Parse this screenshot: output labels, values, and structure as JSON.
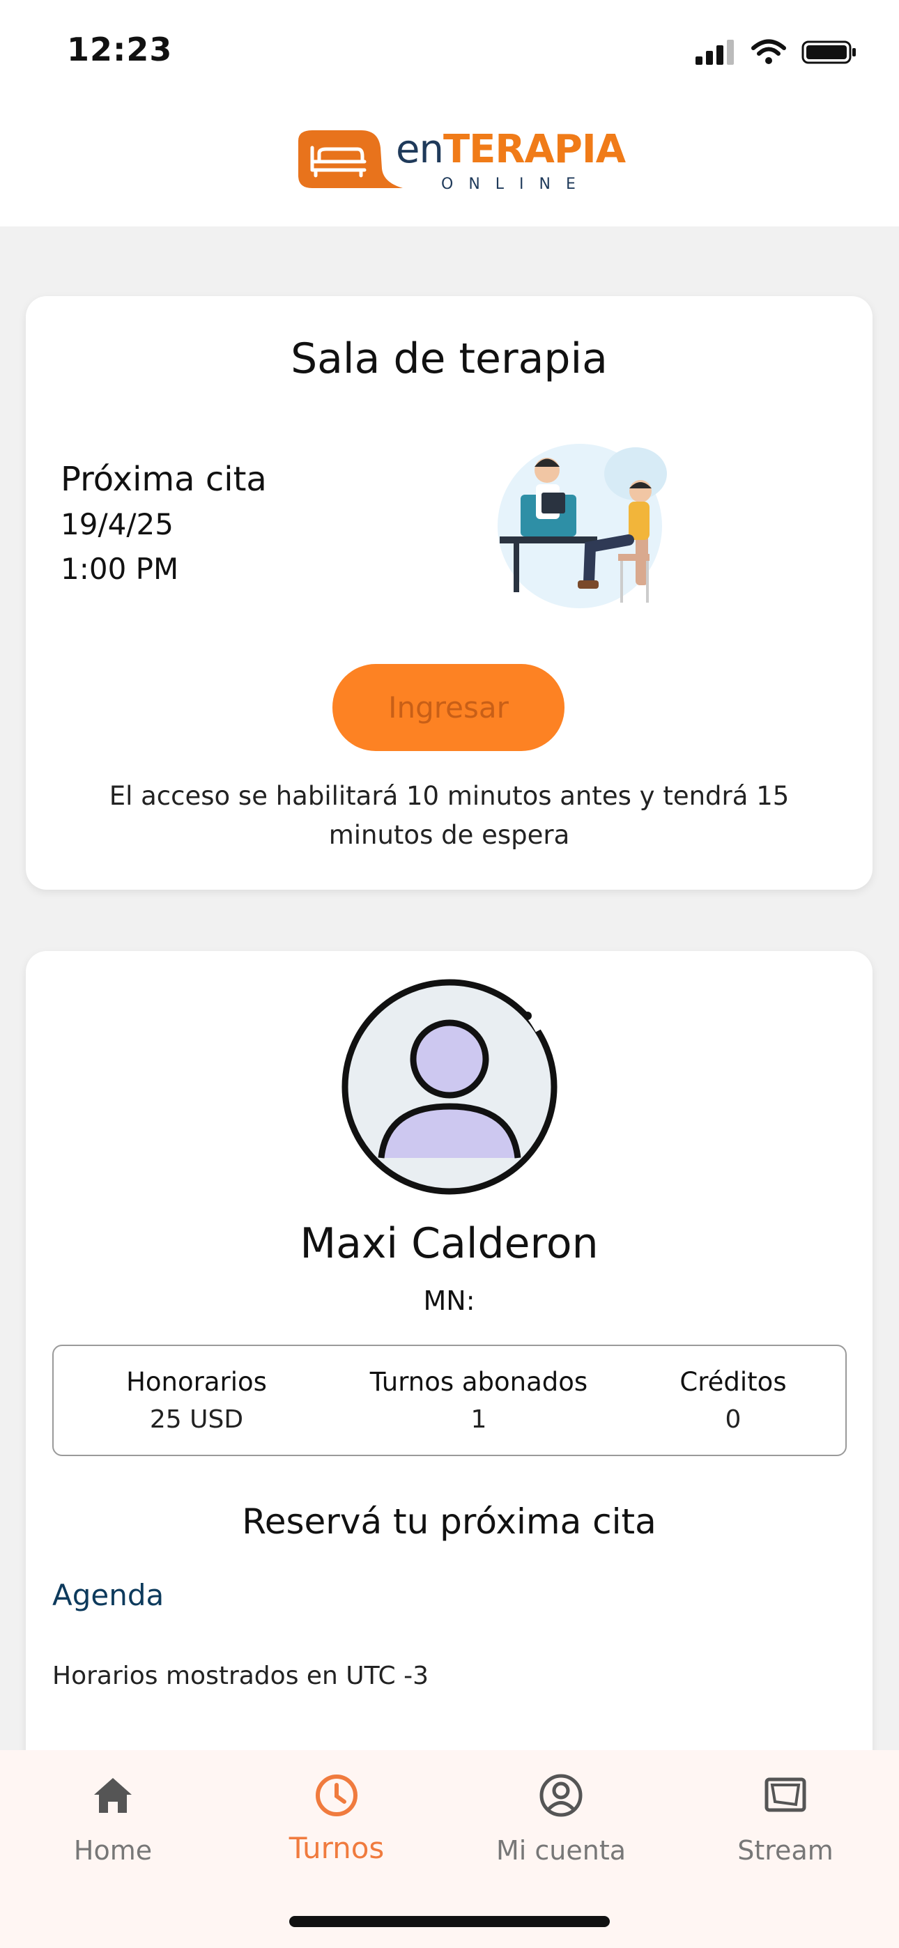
{
  "status_bar": {
    "time": "12:23"
  },
  "header": {
    "logo_en": "en",
    "logo_terapia": "TERAPIA",
    "logo_online": "ONLINE"
  },
  "therapy_room": {
    "title": "Sala de terapia",
    "next_label": "Próxima cita",
    "next_date": "19/4/25",
    "next_time": "1:00 PM",
    "enter_button": "Ingresar",
    "access_note": "El acceso se habilitará 10 minutos antes y tendrá 15 minutos de espera"
  },
  "profile": {
    "name": "Maxi Calderon",
    "mn": "MN:",
    "stats": [
      {
        "label": "Honorarios",
        "value": "25 USD"
      },
      {
        "label": "Turnos abonados",
        "value": "1"
      },
      {
        "label": "Créditos",
        "value": "0"
      }
    ],
    "book_title": "Reservá tu próxima cita",
    "agenda_link": "Agenda",
    "utc_note": "Horarios mostrados en UTC -3"
  },
  "bottom_nav": {
    "items": [
      {
        "label": "Home",
        "icon": "home-icon"
      },
      {
        "label": "Turnos",
        "icon": "clock-icon",
        "active": true
      },
      {
        "label": "Mi cuenta",
        "icon": "user-circle-icon"
      },
      {
        "label": "Stream",
        "icon": "stream-icon"
      }
    ]
  },
  "colors": {
    "accent": "#fd8223",
    "brand_blue": "#1f3a5a",
    "nav_active": "#f07b3e"
  }
}
